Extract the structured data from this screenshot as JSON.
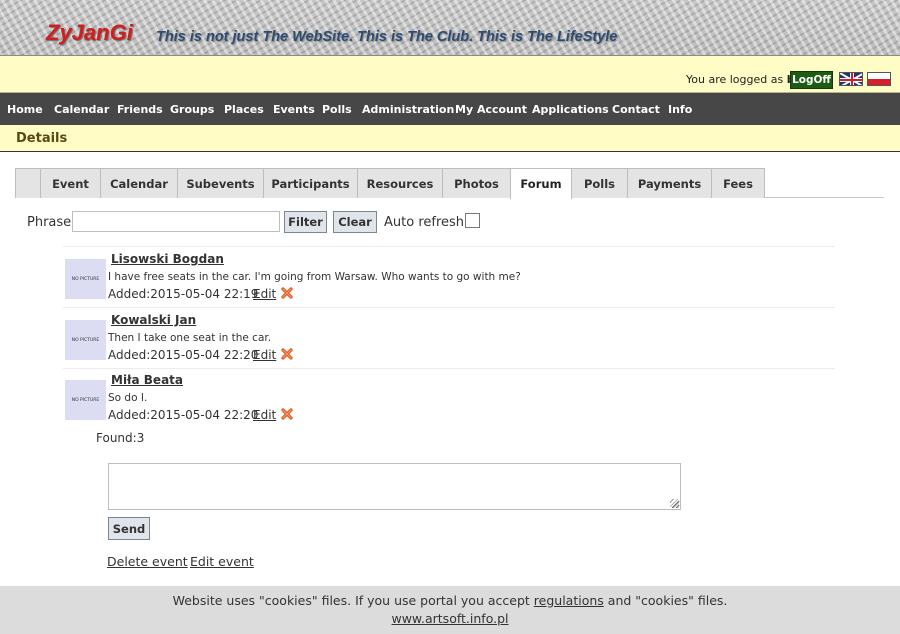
{
  "header": {
    "logo": "ZyJanGi",
    "slogan": "This is not just The WebSite. This is The Club. This is The LifeStyle"
  },
  "login": {
    "prefix": "You are logged as",
    "user": "bl",
    "logoff_label": "LogOff",
    "flags": [
      "english-flag-icon",
      "polish-flag-icon"
    ]
  },
  "menu": {
    "items": [
      "Home",
      "Calendar",
      "Friends",
      "Groups",
      "Places",
      "Events",
      "Polls",
      "Administration",
      "My Account",
      "Applications",
      "Contact",
      "Info"
    ]
  },
  "details": {
    "title": "Details"
  },
  "tabs": {
    "items": [
      "",
      "Event",
      "Calendar",
      "Subevents",
      "Participants",
      "Resources",
      "Photos",
      "Forum",
      "Polls",
      "Payments",
      "Fees"
    ],
    "active": "Forum"
  },
  "filter": {
    "phrase_label": "Phrase:",
    "phrase_value": "",
    "filter_label": "Filter",
    "clear_label": "Clear",
    "auto_refresh_label": "Auto refresh",
    "auto_refresh_checked": false
  },
  "posts": [
    {
      "avatar_text": "NO PICTURE",
      "author": "Lisowski Bogdan",
      "text": "I have free seats in the car. I'm going from Warsaw. Who wants to go with me?",
      "added": "Added:2015-05-04 22:19",
      "edit_label": "Edit",
      "delete_icon": "delete-icon"
    },
    {
      "avatar_text": "NO PICTURE",
      "author": "Kowalski Jan",
      "text": "Then I take one seat in the car.",
      "added": "Added:2015-05-04 22:20",
      "edit_label": "Edit",
      "delete_icon": "delete-icon"
    },
    {
      "avatar_text": "NO PICTURE",
      "author": "Miła Beata",
      "text": "So do I.",
      "added": "Added:2015-05-04 22:20",
      "edit_label": "Edit",
      "delete_icon": "delete-icon"
    }
  ],
  "found": "Found:3",
  "reply": {
    "value": "",
    "send_label": "Send"
  },
  "actions": {
    "delete_event": "Delete event",
    "edit_event": "Edit event"
  },
  "footer": {
    "text_before": "Website uses \"cookies\" files. If you use portal you accept",
    "regulations": "regulations",
    "text_after": "and \"cookies\" files.",
    "link": "www.artsoft.info.pl"
  },
  "colors": {
    "menu_bg": "#474747",
    "yellow_bar": "#fffcc6",
    "logo_red": "#d21e1e",
    "slogan_blue": "#2e4c72",
    "logoff_green": "#1e5c16",
    "footer_bg": "#dcdcdc"
  }
}
